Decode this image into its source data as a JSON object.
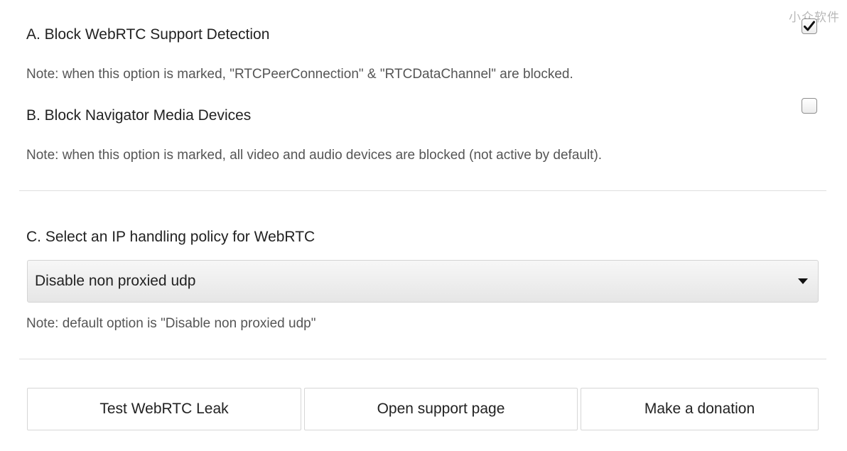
{
  "watermark": "小众软件",
  "options": {
    "a": {
      "title": "A. Block WebRTC Support Detection",
      "note": "Note: when this option is marked, \"RTCPeerConnection\" & \"RTCDataChannel\" are blocked.",
      "checked": true
    },
    "b": {
      "title": "B. Block Navigator Media Devices",
      "note": "Note: when this option is marked, all video and audio devices are blocked (not active by default).",
      "checked": false
    },
    "c": {
      "title": "C. Select an IP handling policy for WebRTC",
      "selected": "Disable non proxied udp",
      "note": "Note: default option is \"Disable non proxied udp\""
    }
  },
  "buttons": {
    "test": "Test WebRTC Leak",
    "support": "Open support page",
    "donate": "Make a donation"
  }
}
